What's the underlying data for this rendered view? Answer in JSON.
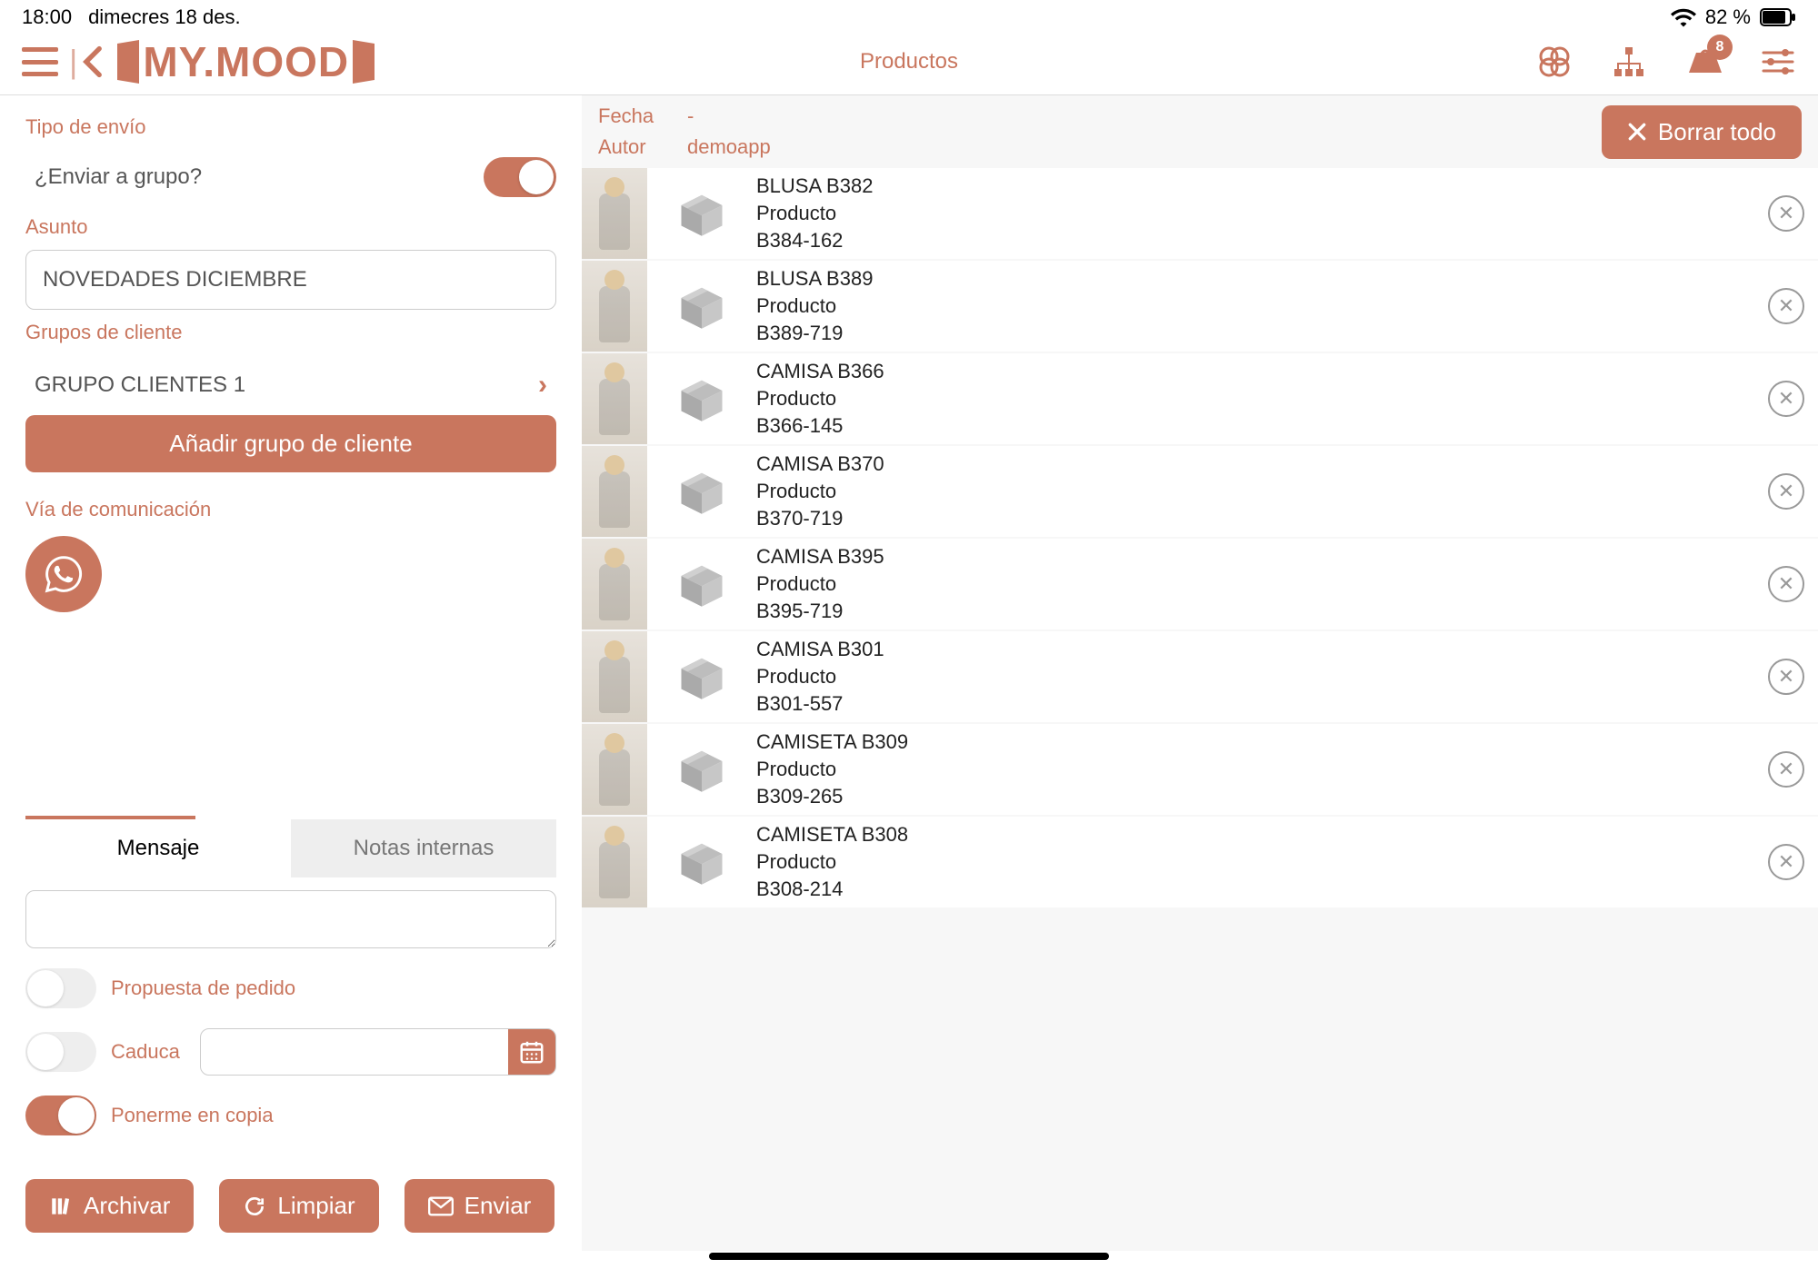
{
  "status": {
    "time": "18:00",
    "date": "dimecres 18 des.",
    "battery": "82 %"
  },
  "header": {
    "title": "Productos",
    "logo": "MY.MOOD",
    "badge": "8"
  },
  "left": {
    "tipo_envio_label": "Tipo de envío",
    "send_group_question": "¿Enviar a grupo?",
    "asunto_label": "Asunto",
    "asunto_value": "NOVEDADES DICIEMBRE",
    "grupos_label": "Grupos de cliente",
    "grupo_selected": "GRUPO CLIENTES 1",
    "add_group_btn": "Añadir grupo de cliente",
    "via_label": "Vía de comunicación",
    "tab_message": "Mensaje",
    "tab_notes": "Notas internas",
    "propuesta_label": "Propuesta de pedido",
    "caduca_label": "Caduca",
    "copia_label": "Ponerme en copia",
    "archive_btn": "Archivar",
    "clear_btn": "Limpiar",
    "send_btn": "Enviar"
  },
  "right": {
    "fecha_label": "Fecha",
    "fecha_value": "-",
    "autor_label": "Autor",
    "autor_value": "demoapp",
    "clear_all_btn": "Borrar todo",
    "type_label": "Producto",
    "products": [
      {
        "name": "BLUSA B382",
        "code": "B384-162"
      },
      {
        "name": "BLUSA B389",
        "code": "B389-719"
      },
      {
        "name": "CAMISA B366",
        "code": "B366-145"
      },
      {
        "name": "CAMISA B370",
        "code": "B370-719"
      },
      {
        "name": "CAMISA B395",
        "code": "B395-719"
      },
      {
        "name": "CAMISA B301",
        "code": "B301-557"
      },
      {
        "name": "CAMISETA B309",
        "code": "B309-265"
      },
      {
        "name": "CAMISETA B308",
        "code": "B308-214"
      }
    ]
  }
}
